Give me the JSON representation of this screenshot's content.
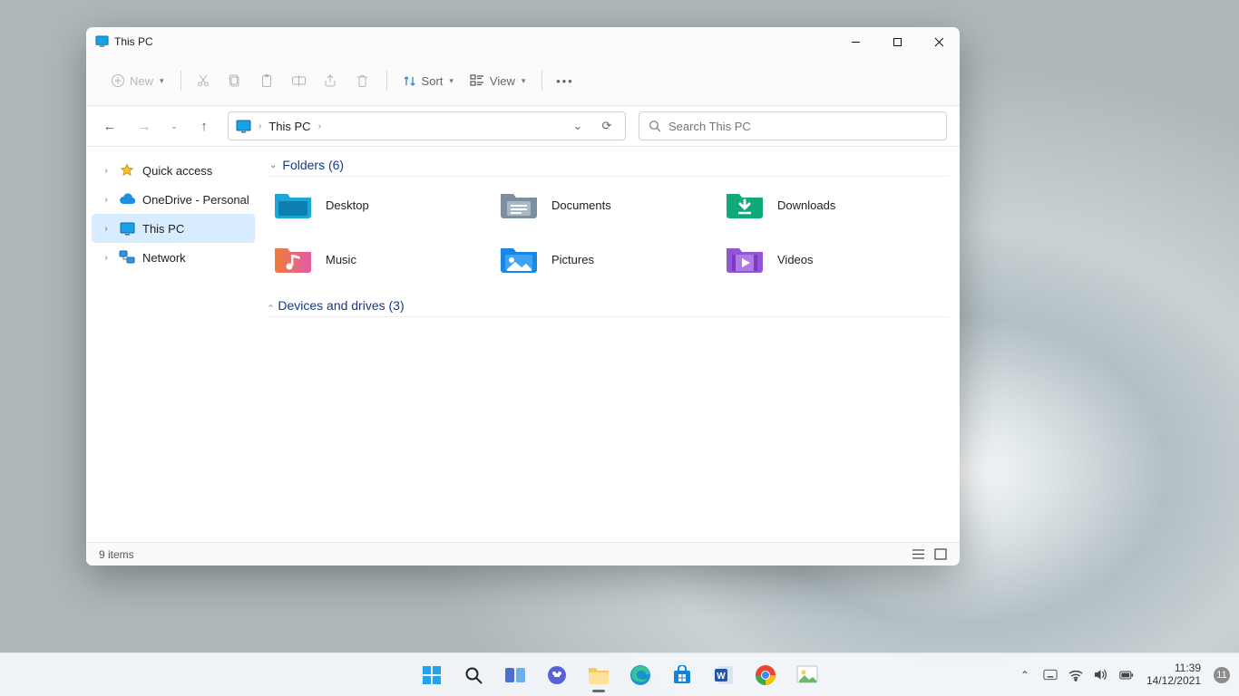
{
  "window": {
    "title": "This PC",
    "toolbar": {
      "new_label": "New",
      "sort_label": "Sort",
      "view_label": "View"
    },
    "breadcrumb": {
      "location": "This PC"
    },
    "search": {
      "placeholder": "Search This PC"
    },
    "status": {
      "item_count": "9 items"
    }
  },
  "nav_pane": {
    "items": [
      {
        "label": "Quick access"
      },
      {
        "label": "OneDrive - Personal"
      },
      {
        "label": "This PC"
      },
      {
        "label": "Network"
      }
    ]
  },
  "groups": {
    "folders": {
      "header": "Folders (6)",
      "items": [
        {
          "label": "Desktop"
        },
        {
          "label": "Documents"
        },
        {
          "label": "Downloads"
        },
        {
          "label": "Music"
        },
        {
          "label": "Pictures"
        },
        {
          "label": "Videos"
        }
      ]
    },
    "devices": {
      "header": "Devices and drives (3)"
    }
  },
  "taskbar": {
    "clock": {
      "time": "11:39",
      "date": "14/12/2021"
    },
    "notifications": "11"
  }
}
